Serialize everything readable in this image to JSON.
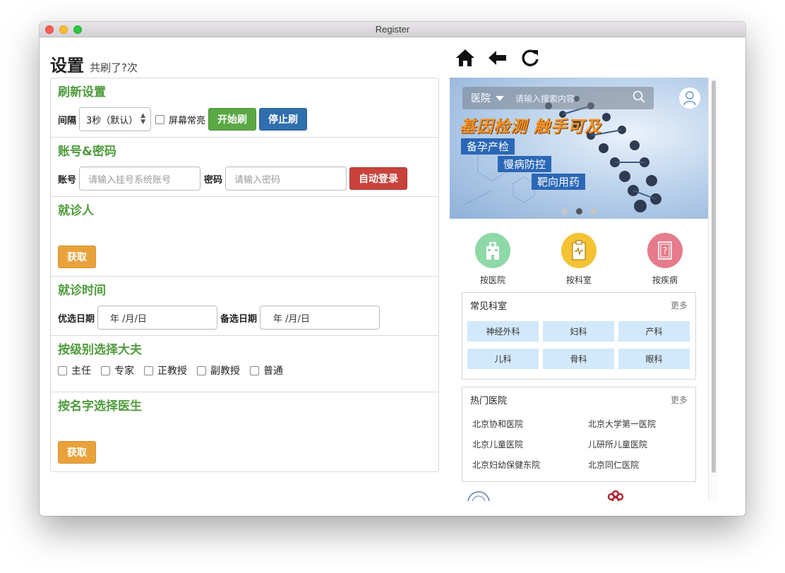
{
  "window": {
    "title": "Register"
  },
  "header": {
    "title": "设置",
    "subtitle": "共刷了?次"
  },
  "refresh": {
    "title": "刷新设置",
    "interval_label": "间隔",
    "interval_value": "3秒（默认）",
    "screen_on_label": "屏幕常亮",
    "start_label": "开始刷",
    "stop_label": "停止刷"
  },
  "account": {
    "title": "账号&密码",
    "account_label": "账号",
    "account_placeholder": "请输入挂号系统账号",
    "password_label": "密码",
    "password_placeholder": "请输入密码",
    "auto_login_label": "自动登录"
  },
  "patient": {
    "title": "就诊人",
    "fetch_label": "获取"
  },
  "visit_time": {
    "title": "就诊时间",
    "preferred_label": "优选日期",
    "preferred_value": "年 /月/日",
    "alt_label": "备选日期",
    "alt_value": "年 /月/日"
  },
  "doctor_level": {
    "title": "按级别选择大夫",
    "options": [
      "主任",
      "专家",
      "正教授",
      "副教授",
      "普通"
    ]
  },
  "doctor_name": {
    "title": "按名字选择医生",
    "fetch_label": "获取"
  },
  "browser": {
    "nav_icons": [
      "home-icon",
      "back-arrow-icon",
      "reload-icon"
    ]
  },
  "mobile": {
    "search": {
      "city": "医院",
      "placeholder": "请输入搜索内容"
    },
    "banner": {
      "slogan": "基因检测 触手可及",
      "tags": [
        "备孕产检",
        "慢病防控",
        "靶向用药"
      ],
      "active_dot": 1
    },
    "categories": [
      {
        "label": "按医院",
        "color": "#8fd8a8",
        "icon": "hospital-icon"
      },
      {
        "label": "按科室",
        "color": "#f4c232",
        "icon": "clipboard-icon"
      },
      {
        "label": "按疾病",
        "color": "#e57b8b",
        "icon": "book-question-icon"
      }
    ],
    "departments": {
      "title": "常见科室",
      "more": "更多",
      "items": [
        "神经外科",
        "妇科",
        "产科",
        "儿科",
        "骨科",
        "眼科"
      ]
    },
    "hospitals": {
      "title": "热门医院",
      "more": "更多",
      "items": [
        "北京协和医院",
        "北京大学第一医院",
        "北京儿童医院",
        "儿研所儿童医院",
        "北京妇幼保健东院",
        "北京同仁医院"
      ]
    }
  }
}
